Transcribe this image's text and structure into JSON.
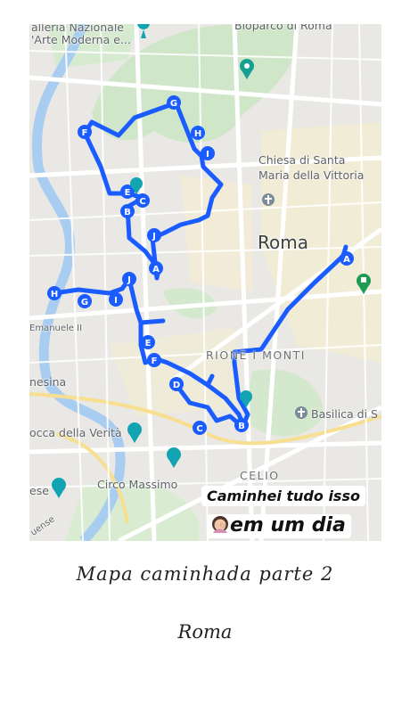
{
  "map": {
    "labels": {
      "gallery": "alleria Nazionale",
      "gallery2": "'Arte Moderna e...",
      "bioparco": "Bioparco di Roma",
      "church1": "Chiesa di Santa",
      "church2": "Maria della Vittoria",
      "roma": "Roma",
      "rione": "RIONE I MONTI",
      "emanuele": "Emanuele II",
      "nesina": "nesina",
      "bocca": "occa della Verità",
      "basilica": "Basilica di S",
      "celio": "CELIO",
      "circo": "Circo Massimo",
      "ese": "ese",
      "uense": "uense"
    },
    "route_color": "#1a5cff",
    "waypoints": [
      "G",
      "H",
      "I",
      "F",
      "E",
      "C",
      "B",
      "J",
      "A",
      "H",
      "G",
      "I",
      "J",
      "E",
      "F",
      "D",
      "C",
      "B",
      "A"
    ]
  },
  "story": {
    "line1": "Caminhei tudo isso",
    "line2": "em um dia",
    "emoji": "face-palm-emoji"
  },
  "caption": {
    "title": "Mapa caminhada  parte 2",
    "subtitle": "Roma"
  }
}
